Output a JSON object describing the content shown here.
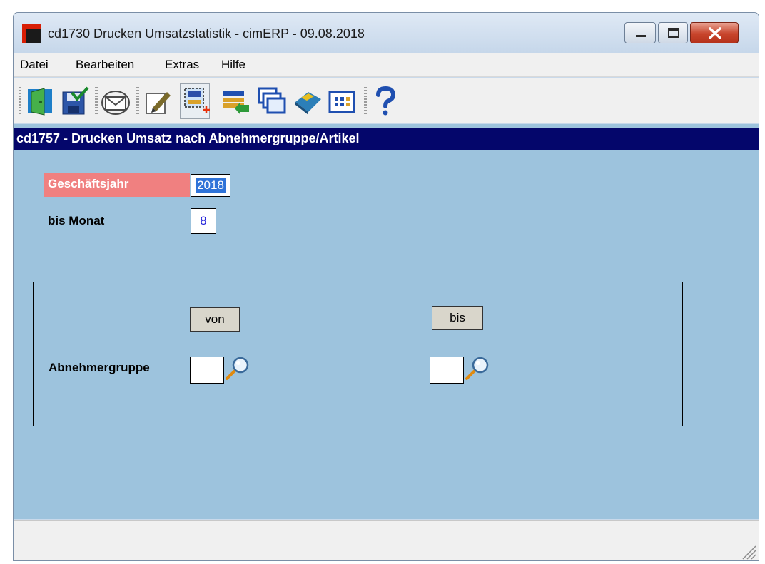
{
  "window": {
    "title": "cd1730 Drucken Umsatzstatistik - cimERP - 09.08.2018"
  },
  "menu": {
    "items": [
      "Datei",
      "Bearbeiten",
      "Extras",
      "Hilfe"
    ]
  },
  "toolbar": {
    "buttons": [
      {
        "icon": "exit-door-icon"
      },
      {
        "icon": "save-check-icon"
      },
      {
        "icon": "mail-envelope-icon"
      },
      {
        "icon": "edit-document-icon"
      },
      {
        "icon": "new-selection-icon"
      },
      {
        "icon": "list-import-icon"
      },
      {
        "icon": "windows-cascade-icon"
      },
      {
        "icon": "book-icon"
      },
      {
        "icon": "table-grid-icon"
      },
      {
        "icon": "help-question-icon"
      }
    ]
  },
  "section": {
    "title": "cd1757 - Drucken Umsatz nach Abnehmergruppe/Artikel"
  },
  "form": {
    "fiscal_year_label": "Geschäftsjahr",
    "fiscal_year_value": "2018",
    "month_label": "bis Monat",
    "month_value": "8",
    "from_label": "von",
    "to_label": "bis",
    "customer_group_label": "Abnehmergruppe",
    "customer_group_from": "",
    "customer_group_to": ""
  },
  "colors": {
    "header_bg": "#04066b",
    "content_bg": "#9dc3dd",
    "required_label_bg": "#f08080"
  }
}
